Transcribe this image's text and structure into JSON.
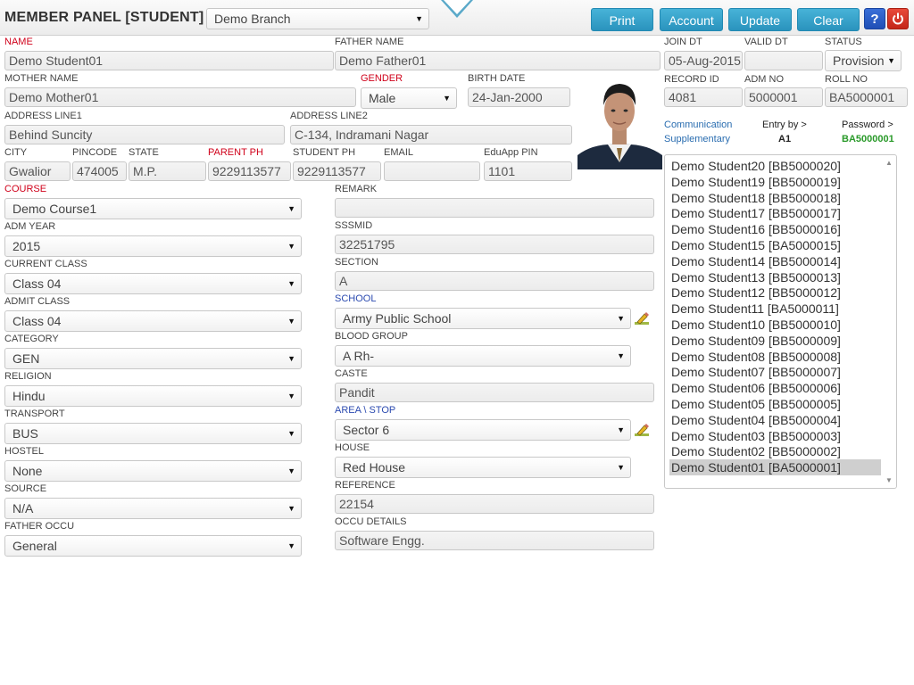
{
  "header": {
    "title": "MEMBER PANEL [STUDENT]",
    "branch": "Demo Branch",
    "buttons": {
      "print": "Print",
      "account": "Account",
      "update": "Update",
      "clear": "Clear"
    },
    "help_label": "?",
    "accent": "#2a93bd"
  },
  "labels": {
    "name": "NAME",
    "father_name": "FATHER NAME",
    "join_dt": "JOIN DT",
    "valid_dt": "VALID DT",
    "status": "STATUS",
    "mother_name": "MOTHER NAME",
    "gender": "GENDER",
    "birth_date": "BIRTH DATE",
    "record_id": "RECORD ID",
    "adm_no": "ADM NO",
    "roll_no": "ROLL NO",
    "address1": "ADDRESS LINE1",
    "address2": "ADDRESS LINE2",
    "city": "CITY",
    "pincode": "PINCODE",
    "state": "STATE",
    "parent_ph": "PARENT PH",
    "student_ph": "STUDENT PH",
    "email": "EMAIL",
    "eduapp_pin": "EduApp PIN",
    "course": "COURSE",
    "remark": "REMARK",
    "adm_year": "ADM YEAR",
    "sssmid": "SSSMID",
    "current_class": "CURRENT CLASS",
    "section": "SECTION",
    "admit_class": "ADMIT CLASS",
    "school": "SCHOOL",
    "category": "CATEGORY",
    "blood_group": "BLOOD GROUP",
    "religion": "RELIGION",
    "caste": "CASTE",
    "transport": "TRANSPORT",
    "area_stop": "AREA \\ STOP",
    "hostel": "HOSTEL",
    "house": "HOUSE",
    "source": "SOURCE",
    "reference": "REFERENCE",
    "father_occu": "FATHER OCCU",
    "occu_details": "OCCU DETAILS"
  },
  "values": {
    "name": "Demo Student01",
    "father_name": "Demo Father01",
    "join_dt": "05-Aug-2015",
    "valid_dt": "",
    "status": "Provision",
    "mother_name": "Demo Mother01",
    "gender": "Male",
    "birth_date": "24-Jan-2000",
    "record_id": "4081",
    "adm_no": "5000001",
    "roll_no": "BA5000001",
    "address1": "Behind Suncity",
    "address2": "C-134, Indramani Nagar",
    "city": "Gwalior",
    "pincode": "474005",
    "state": "M.P.",
    "parent_ph": "9229113577",
    "student_ph": "9229113577",
    "email": "",
    "eduapp_pin": "1101",
    "course": "Demo Course1",
    "remark": "",
    "adm_year": "2015",
    "sssmid": "32251795",
    "current_class": "Class 04",
    "section": "A",
    "admit_class": "Class 04",
    "school": "Army Public School",
    "category": "GEN",
    "blood_group": "A Rh-",
    "religion": "Hindu",
    "caste": "Pandit",
    "transport": "BUS",
    "area_stop": "Sector 6",
    "hostel": "None",
    "house": "Red House",
    "source": "N/A",
    "reference": "22154",
    "father_occu": "General",
    "occu_details": "Software Engg."
  },
  "info": {
    "communication": "Communication",
    "supplementary": "Supplementary",
    "entry_by_label": "Entry by >",
    "entry_by_value": "A1",
    "password_label": "Password >",
    "password_value": "BA5000001"
  },
  "student_list": [
    "Demo Student20 [BB5000020]",
    "Demo Student19 [BB5000019]",
    "Demo Student18 [BB5000018]",
    "Demo Student17 [BB5000017]",
    "Demo Student16 [BB5000016]",
    "Demo Student15 [BA5000015]",
    "Demo Student14 [BB5000014]",
    "Demo Student13 [BB5000013]",
    "Demo Student12 [BB5000012]",
    "Demo Student11 [BA5000011]",
    "Demo Student10 [BB5000010]",
    "Demo Student09 [BB5000009]",
    "Demo Student08 [BB5000008]",
    "Demo Student07 [BB5000007]",
    "Demo Student06 [BB5000006]",
    "Demo Student05 [BB5000005]",
    "Demo Student04 [BB5000004]",
    "Demo Student03 [BB5000003]",
    "Demo Student02 [BB5000002]",
    "Demo Student01 [BA5000001]"
  ],
  "selected_student": "Demo Student01 [BA5000001]"
}
